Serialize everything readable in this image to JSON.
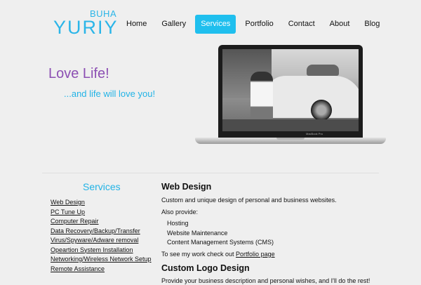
{
  "logo": {
    "top": "BUHA",
    "main": "YURIY"
  },
  "nav": [
    "Home",
    "Gallery",
    "Services",
    "Portfolio",
    "Contact",
    "About",
    "Blog"
  ],
  "nav_active": "Services",
  "tagline": {
    "line1": "Love Life!",
    "line2": "...and life will love you!"
  },
  "laptop": {
    "brand": "MacBook Pro"
  },
  "services": {
    "title": "Services",
    "items": [
      "Web Design",
      "PC Tune Up",
      "Computer Repair",
      "Data Recovery/Backup/Transfer",
      "Virus/Spyware/Adware removal",
      "Opeartion System Installation",
      "Networking/Wireless Network Setup",
      "Remote Assistance"
    ]
  },
  "main": {
    "web_design": {
      "heading": "Web Design",
      "desc": "Custom and unique design of personal and business websites.",
      "also": "Also provide:",
      "items": [
        "Hosting",
        "Website Maintenance",
        "Content Management Systems (CMS)"
      ],
      "portfolio_prefix": "To see my work check out ",
      "portfolio_link": "Portfolio page"
    },
    "logo_design": {
      "heading": "Custom Logo Design",
      "desc": "Provide your business description and personal wishes, and I'll do the rest!"
    }
  },
  "colors": {
    "accent": "#1fbfee",
    "tagline_purple": "#8c4fb3",
    "background": "#efefef"
  }
}
